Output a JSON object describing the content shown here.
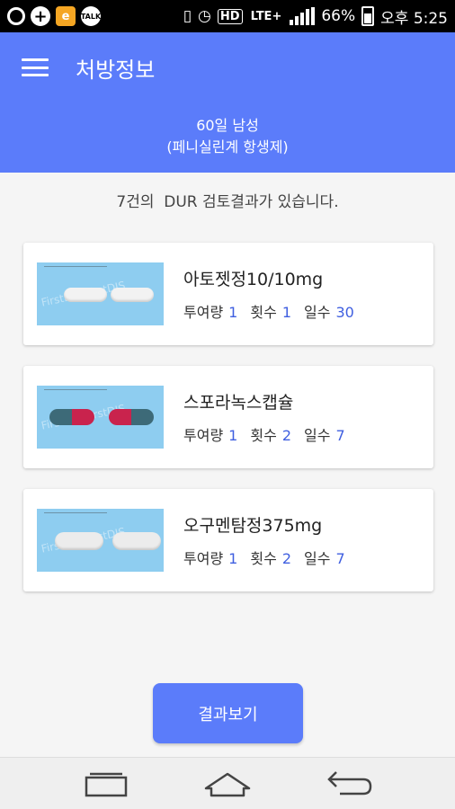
{
  "status_bar": {
    "hd": "HD",
    "lte": "LTE+",
    "battery": "66%",
    "time": "오후 5:25"
  },
  "app_bar": {
    "title": "처방정보",
    "patient_line1": "60일 남성",
    "patient_line2": "(페니실린계 항생제)"
  },
  "dur_note": "7건의  DUR 검토결과가 있습니다.",
  "dose_labels": {
    "amount": "투여량",
    "times": "횟수",
    "days": "일수"
  },
  "drugs": [
    {
      "name": "아토젯정10/10mg",
      "amount": "1",
      "times": "1",
      "days": "30",
      "image_icon": "white-oblong-tablet"
    },
    {
      "name": "스포라녹스캡슐",
      "amount": "1",
      "times": "2",
      "days": "7",
      "image_icon": "teal-red-capsule"
    },
    {
      "name": "오구멘탐정375mg",
      "amount": "1",
      "times": "2",
      "days": "7",
      "image_icon": "white-oval-tablet"
    }
  ],
  "result_button": "결과보기",
  "nav": {
    "recent_icon": "recent-apps-icon",
    "home_icon": "home-icon",
    "back_icon": "back-icon"
  },
  "colors": {
    "primary": "#5b7cfa",
    "value_text": "#3f5fe0",
    "thumb_bg": "#8ecdf0"
  }
}
